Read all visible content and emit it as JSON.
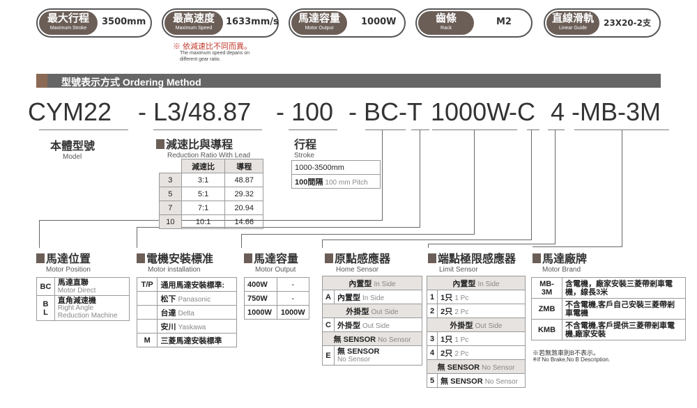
{
  "specs": [
    {
      "cn": "最大行程",
      "en": "Maximum Stroke",
      "value": "3500mm"
    },
    {
      "cn": "最高速度",
      "en": "Maximum Speed",
      "value": "1633mm/s"
    },
    {
      "cn": "馬達容量",
      "en": "Motor Output",
      "value": "1000W"
    },
    {
      "cn": "齒條",
      "en": "Rack",
      "value": "M2"
    },
    {
      "cn": "直線滑軌",
      "en": "Linear Guide",
      "value": "23X20-2支"
    }
  ],
  "speed_note": {
    "cn": "※ 依減速比不同而異。",
    "en1": "The maximum speed depans on",
    "en2": "different gear ratio."
  },
  "ordering_title": "型號表示方式  Ordering Method",
  "model_parts": [
    "CYM22",
    "- L3/48.87",
    "- 100",
    "- BC-T",
    "1000W",
    "-C",
    "4",
    "-MB-3M"
  ],
  "model": {
    "cn": "本體型號",
    "en": "Model"
  },
  "reduction": {
    "cn": "減速比與導程",
    "en": "Reduction Ratio With  Lead",
    "headers": [
      "減速比",
      "導程"
    ],
    "rows": [
      [
        "3",
        "3:1",
        "48.87"
      ],
      [
        "5",
        "5:1",
        "29.32"
      ],
      [
        "7",
        "7:1",
        "20.94"
      ],
      [
        "10",
        "10:1",
        "14.66"
      ]
    ]
  },
  "stroke": {
    "cn": "行程",
    "en": "Stroke",
    "range": "1000-3500mm",
    "pitch_cn": "100間隔",
    "pitch_en": "100 mm Pitch"
  },
  "motor_position": {
    "cn": "馬達位置",
    "en": "Motor Position",
    "rows": [
      {
        "code": "BC",
        "cn": "馬達直聯",
        "en": "Motor Direct"
      },
      {
        "code": "B L",
        "cn": "直角減速機",
        "en": "Right Angle Reduction Machine"
      }
    ]
  },
  "motor_install": {
    "cn": "電機安裝標准",
    "en": "Motor installation",
    "rows": [
      {
        "code": "T/P",
        "cn": "通用馬達安裝標準:",
        "en": ""
      },
      {
        "code": "",
        "cn": "松下",
        "en": "Panasonic"
      },
      {
        "code": "",
        "cn": "台達",
        "en": "Delta"
      },
      {
        "code": "",
        "cn": "安川",
        "en": "Yaskawa"
      },
      {
        "code": "M",
        "cn": "三菱馬達安裝標準",
        "en": ""
      }
    ]
  },
  "motor_output": {
    "cn": "馬達容量",
    "en": "Motor Output",
    "rows": [
      [
        "400W",
        "-"
      ],
      [
        "750W",
        "-"
      ],
      [
        "1000W",
        "1000W"
      ]
    ]
  },
  "home_sensor": {
    "cn": "原點感應器",
    "en": "Home Sensor",
    "in_cn": "內置型",
    "in_en": "In Side",
    "rows": [
      {
        "code": "A",
        "cn": "內置型",
        "en": "In Side"
      },
      {
        "code": "",
        "cn": "外掛型",
        "en": "Out Side",
        "head": true
      },
      {
        "code": "C",
        "cn": "外掛型",
        "en": "Out Side"
      },
      {
        "code": "",
        "cn": "無 SENSOR",
        "en": "No Sensor",
        "head": true
      },
      {
        "code": "E",
        "cn": "無  SENSOR",
        "en": "No Sensor"
      }
    ]
  },
  "limit_sensor": {
    "cn": "端點極限感應器",
    "en": "Limit Sensor",
    "in_cn": "內置型",
    "in_en": "In Side",
    "rows": [
      {
        "code": "1",
        "cn": "1只",
        "en": "1 Pc"
      },
      {
        "code": "2",
        "cn": "2只",
        "en": "2 Pc"
      },
      {
        "code": "",
        "cn": "外掛型",
        "en": "Out Side",
        "head": true
      },
      {
        "code": "3",
        "cn": "1只",
        "en": "1 Pc"
      },
      {
        "code": "4",
        "cn": "2只",
        "en": "2 Pc"
      },
      {
        "code": "",
        "cn": "無 SENSOR",
        "en": "No Sensor",
        "head": true
      },
      {
        "code": "5",
        "cn": "無 SENSOR",
        "en": "No Sensor"
      }
    ]
  },
  "motor_brand": {
    "cn": "馬達廠牌",
    "en": "Motor Brand",
    "rows": [
      {
        "code": "MB-3M",
        "desc": "含電機，廠家安裝三菱帶剎車電機，線長3米"
      },
      {
        "code": "ZMB",
        "desc": "不含電機,客戶自己安裝三菱帶剎車電機"
      },
      {
        "code": "KMB",
        "desc": "不含電機,客戶提供三菱帶剎車電機,廠家安裝"
      }
    ],
    "note_cn": "※若無煞車則B不表示。",
    "note_en": "※If No Brake,No B Description."
  },
  "colors": {
    "accent": "#6b5e57",
    "bar": "#666666",
    "note": "#c0392b"
  }
}
